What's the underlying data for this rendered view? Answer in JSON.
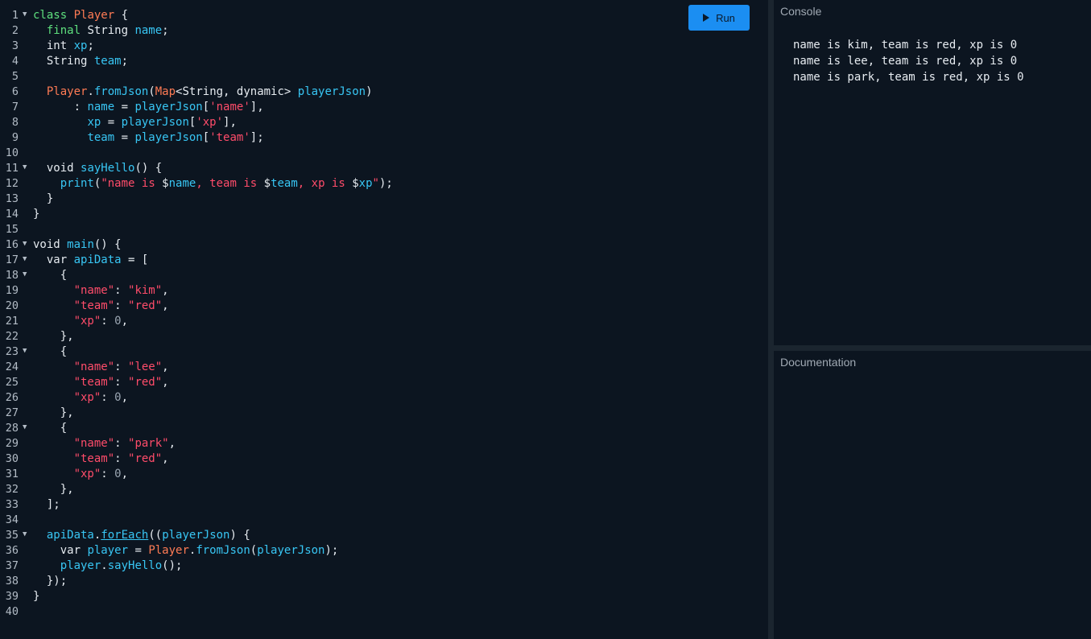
{
  "toolbar": {
    "run_label": "Run"
  },
  "console": {
    "title": "Console",
    "output": [
      "name is kim, team is red, xp is 0",
      "name is lee, team is red, xp is 0",
      "name is park, team is red, xp is 0"
    ]
  },
  "documentation": {
    "title": "Documentation",
    "content": ""
  },
  "editor": {
    "language": "dart",
    "lines": [
      {
        "n": "1",
        "fold": true,
        "tokens": [
          [
            "kw",
            "class"
          ],
          [
            "pl",
            " "
          ],
          [
            "ty",
            "Player"
          ],
          [
            "pl",
            " {"
          ]
        ]
      },
      {
        "n": "2",
        "tokens": [
          [
            "pl",
            "  "
          ],
          [
            "kw",
            "final"
          ],
          [
            "pl",
            " String "
          ],
          [
            "id",
            "name"
          ],
          [
            "pl",
            ";"
          ]
        ]
      },
      {
        "n": "3",
        "tokens": [
          [
            "pl",
            "  int "
          ],
          [
            "id",
            "xp"
          ],
          [
            "pl",
            ";"
          ]
        ]
      },
      {
        "n": "4",
        "tokens": [
          [
            "pl",
            "  String "
          ],
          [
            "id",
            "team"
          ],
          [
            "pl",
            ";"
          ]
        ]
      },
      {
        "n": "5",
        "tokens": []
      },
      {
        "n": "6",
        "tokens": [
          [
            "pl",
            "  "
          ],
          [
            "ty",
            "Player"
          ],
          [
            "pl",
            "."
          ],
          [
            "id",
            "fromJson"
          ],
          [
            "pl",
            "("
          ],
          [
            "ty",
            "Map"
          ],
          [
            "pl",
            "<String, dynamic> "
          ],
          [
            "id",
            "playerJson"
          ],
          [
            "pl",
            ")"
          ]
        ]
      },
      {
        "n": "7",
        "tokens": [
          [
            "pl",
            "      : "
          ],
          [
            "id",
            "name"
          ],
          [
            "pl",
            " = "
          ],
          [
            "id",
            "playerJson"
          ],
          [
            "pl",
            "["
          ],
          [
            "str",
            "'name'"
          ],
          [
            "pl",
            "],"
          ]
        ]
      },
      {
        "n": "8",
        "tokens": [
          [
            "pl",
            "        "
          ],
          [
            "id",
            "xp"
          ],
          [
            "pl",
            " = "
          ],
          [
            "id",
            "playerJson"
          ],
          [
            "pl",
            "["
          ],
          [
            "str",
            "'xp'"
          ],
          [
            "pl",
            "],"
          ]
        ]
      },
      {
        "n": "9",
        "tokens": [
          [
            "pl",
            "        "
          ],
          [
            "id",
            "team"
          ],
          [
            "pl",
            " = "
          ],
          [
            "id",
            "playerJson"
          ],
          [
            "pl",
            "["
          ],
          [
            "str",
            "'team'"
          ],
          [
            "pl",
            "];"
          ]
        ]
      },
      {
        "n": "10",
        "tokens": []
      },
      {
        "n": "11",
        "fold": true,
        "tokens": [
          [
            "pl",
            "  void "
          ],
          [
            "id",
            "sayHello"
          ],
          [
            "pl",
            "() {"
          ]
        ]
      },
      {
        "n": "12",
        "tokens": [
          [
            "pl",
            "    "
          ],
          [
            "id",
            "print"
          ],
          [
            "pl",
            "("
          ],
          [
            "str",
            "\"name is "
          ],
          [
            "pl",
            "$"
          ],
          [
            "id",
            "name"
          ],
          [
            "str",
            ", team is "
          ],
          [
            "pl",
            "$"
          ],
          [
            "id",
            "team"
          ],
          [
            "str",
            ", xp is "
          ],
          [
            "pl",
            "$"
          ],
          [
            "id",
            "xp"
          ],
          [
            "str",
            "\""
          ],
          [
            "pl",
            ");"
          ]
        ]
      },
      {
        "n": "13",
        "tokens": [
          [
            "pl",
            "  }"
          ]
        ]
      },
      {
        "n": "14",
        "tokens": [
          [
            "pl",
            "}"
          ]
        ]
      },
      {
        "n": "15",
        "tokens": []
      },
      {
        "n": "16",
        "fold": true,
        "tokens": [
          [
            "pl",
            "void "
          ],
          [
            "id",
            "main"
          ],
          [
            "pl",
            "() {"
          ]
        ]
      },
      {
        "n": "17",
        "fold": true,
        "tokens": [
          [
            "pl",
            "  var "
          ],
          [
            "id",
            "apiData"
          ],
          [
            "pl",
            " = ["
          ]
        ]
      },
      {
        "n": "18",
        "fold": true,
        "tokens": [
          [
            "pl",
            "    {"
          ]
        ]
      },
      {
        "n": "19",
        "tokens": [
          [
            "pl",
            "      "
          ],
          [
            "str",
            "\"name\""
          ],
          [
            "pl",
            ": "
          ],
          [
            "str",
            "\"kim\""
          ],
          [
            "pl",
            ","
          ]
        ]
      },
      {
        "n": "20",
        "tokens": [
          [
            "pl",
            "      "
          ],
          [
            "str",
            "\"team\""
          ],
          [
            "pl",
            ": "
          ],
          [
            "str",
            "\"red\""
          ],
          [
            "pl",
            ","
          ]
        ]
      },
      {
        "n": "21",
        "tokens": [
          [
            "pl",
            "      "
          ],
          [
            "str",
            "\"xp\""
          ],
          [
            "pl",
            ": "
          ],
          [
            "num",
            "0"
          ],
          [
            "pl",
            ","
          ]
        ]
      },
      {
        "n": "22",
        "tokens": [
          [
            "pl",
            "    },"
          ]
        ]
      },
      {
        "n": "23",
        "fold": true,
        "tokens": [
          [
            "pl",
            "    {"
          ]
        ]
      },
      {
        "n": "24",
        "tokens": [
          [
            "pl",
            "      "
          ],
          [
            "str",
            "\"name\""
          ],
          [
            "pl",
            ": "
          ],
          [
            "str",
            "\"lee\""
          ],
          [
            "pl",
            ","
          ]
        ]
      },
      {
        "n": "25",
        "tokens": [
          [
            "pl",
            "      "
          ],
          [
            "str",
            "\"team\""
          ],
          [
            "pl",
            ": "
          ],
          [
            "str",
            "\"red\""
          ],
          [
            "pl",
            ","
          ]
        ]
      },
      {
        "n": "26",
        "tokens": [
          [
            "pl",
            "      "
          ],
          [
            "str",
            "\"xp\""
          ],
          [
            "pl",
            ": "
          ],
          [
            "num",
            "0"
          ],
          [
            "pl",
            ","
          ]
        ]
      },
      {
        "n": "27",
        "tokens": [
          [
            "pl",
            "    },"
          ]
        ]
      },
      {
        "n": "28",
        "fold": true,
        "tokens": [
          [
            "pl",
            "    {"
          ]
        ]
      },
      {
        "n": "29",
        "tokens": [
          [
            "pl",
            "      "
          ],
          [
            "str",
            "\"name\""
          ],
          [
            "pl",
            ": "
          ],
          [
            "str",
            "\"park\""
          ],
          [
            "pl",
            ","
          ]
        ]
      },
      {
        "n": "30",
        "tokens": [
          [
            "pl",
            "      "
          ],
          [
            "str",
            "\"team\""
          ],
          [
            "pl",
            ": "
          ],
          [
            "str",
            "\"red\""
          ],
          [
            "pl",
            ","
          ]
        ]
      },
      {
        "n": "31",
        "tokens": [
          [
            "pl",
            "      "
          ],
          [
            "str",
            "\"xp\""
          ],
          [
            "pl",
            ": "
          ],
          [
            "num",
            "0"
          ],
          [
            "pl",
            ","
          ]
        ]
      },
      {
        "n": "32",
        "tokens": [
          [
            "pl",
            "    },"
          ]
        ]
      },
      {
        "n": "33",
        "tokens": [
          [
            "pl",
            "  ];"
          ]
        ]
      },
      {
        "n": "34",
        "tokens": []
      },
      {
        "n": "35",
        "fold": true,
        "tokens": [
          [
            "pl",
            "  "
          ],
          [
            "id",
            "apiData"
          ],
          [
            "pl",
            "."
          ],
          [
            "idu",
            "forEach"
          ],
          [
            "pl",
            "(("
          ],
          [
            "id",
            "playerJson"
          ],
          [
            "pl",
            ") {"
          ]
        ]
      },
      {
        "n": "36",
        "tokens": [
          [
            "pl",
            "    var "
          ],
          [
            "id",
            "player"
          ],
          [
            "pl",
            " = "
          ],
          [
            "ty",
            "Player"
          ],
          [
            "pl",
            "."
          ],
          [
            "id",
            "fromJson"
          ],
          [
            "pl",
            "("
          ],
          [
            "id",
            "playerJson"
          ],
          [
            "pl",
            ");"
          ]
        ]
      },
      {
        "n": "37",
        "tokens": [
          [
            "pl",
            "    "
          ],
          [
            "id",
            "player"
          ],
          [
            "pl",
            "."
          ],
          [
            "id",
            "sayHello"
          ],
          [
            "pl",
            "();"
          ]
        ]
      },
      {
        "n": "38",
        "tokens": [
          [
            "pl",
            "  });"
          ]
        ]
      },
      {
        "n": "39",
        "tokens": [
          [
            "pl",
            "}"
          ]
        ]
      },
      {
        "n": "40",
        "tokens": []
      }
    ]
  }
}
